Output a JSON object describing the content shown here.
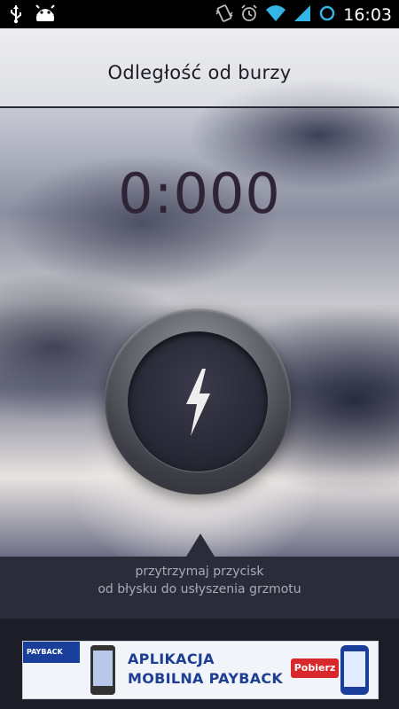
{
  "status_bar": {
    "time": "16:03",
    "icons": [
      "usb-icon",
      "android-icon",
      "vibrate-icon",
      "alarm-icon",
      "wifi-icon",
      "signal-icon",
      "sync-icon"
    ]
  },
  "app": {
    "title": "Odległość od burzy",
    "timer": "0:000",
    "button_icon": "lightning-bolt-icon",
    "hint_line1": "przytrzymaj przycisk",
    "hint_line2": "od błysku do usłyszenia grzmotu"
  },
  "ad": {
    "brand": "PAYBACK",
    "line1": "APLIKACJA",
    "line2": "MOBILNA PAYBACK",
    "cta": "Pobierz"
  },
  "colors": {
    "accent_blue": "#33b5e5",
    "ad_blue": "#1d3e92",
    "ad_red": "#d8282b"
  }
}
